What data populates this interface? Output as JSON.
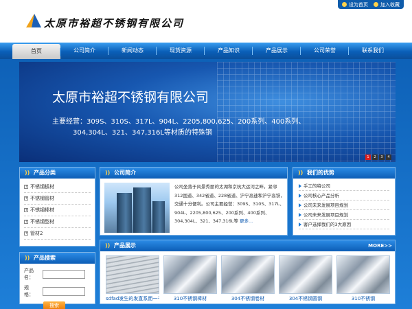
{
  "header": {
    "site_name": "太原市裕超不锈钢有限公司",
    "top_links": [
      "设为首页",
      "加入收藏"
    ]
  },
  "nav": [
    "首页",
    "公司简介",
    "新闻动态",
    "现货资源",
    "产品知识",
    "产品展示",
    "公司荣誉",
    "联系我们"
  ],
  "banner": {
    "title": "太原市裕超不锈钢有限公司",
    "line1": "主要经营：309S、310S、317L、904L、2205,800,625、200系列、400系列、",
    "line2": "304,304L、321、347,316L等材质的特殊钢",
    "pages": [
      "1",
      "2",
      "3",
      "4"
    ]
  },
  "categories": {
    "title": "产品分类",
    "items": [
      "不锈钢板材",
      "不锈钢管材",
      "不锈钢棒材",
      "不锈钢型材",
      "管材2"
    ]
  },
  "intro": {
    "title": "公司简介",
    "text": "公司坐落于风景秀丽的太湖和京杭大运河之畔，紧邻312国道、342省道、228省道、沪宁高速和沪宁高铁，交通十分便利。公司主要经营：309S、310S、317L、904L、2205,800,625、200系列、400系列、304,304L、321、347,316L等",
    "more": "更多..."
  },
  "advantages": {
    "title": "我们的优势",
    "items": [
      "手工的特公司",
      "公司核心产品分析",
      "公司未来发展项目规划",
      "公司未来发展项目规划",
      "客户选择我们的3大原因"
    ]
  },
  "search": {
    "title": "产品搜索",
    "name_label": "产品名：",
    "spec_label": "规　格：",
    "button": "搜索"
  },
  "products": {
    "title": "产品展示",
    "more": "MORE>>",
    "items": [
      "sdfad发生的发直系而一千",
      "310不锈钢棒材",
      "304不锈钢卷材",
      "304不锈钢圆钢",
      "310不锈钢"
    ]
  }
}
